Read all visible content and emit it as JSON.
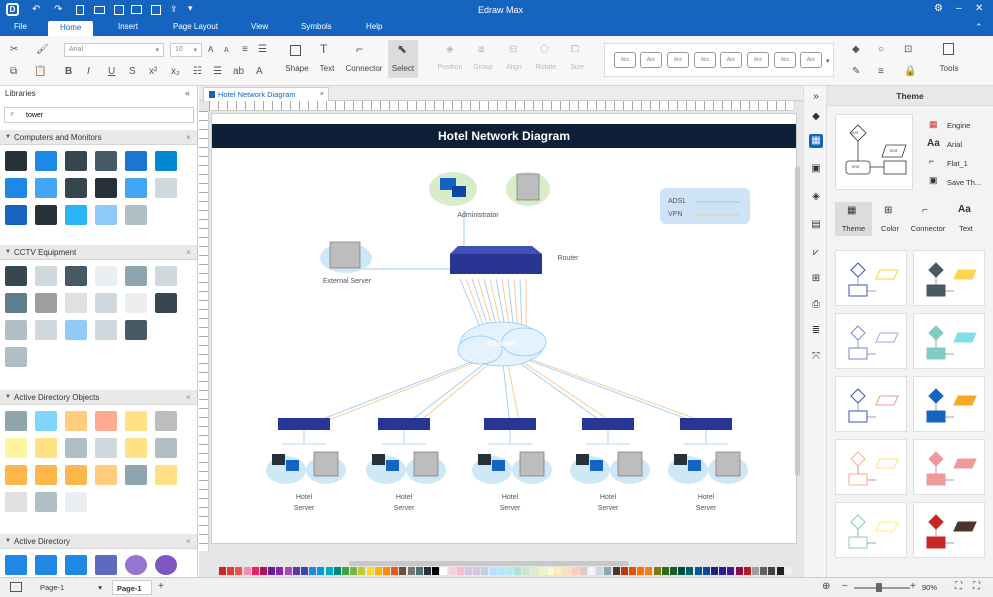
{
  "app": {
    "title": "Edraw Max"
  },
  "menus": [
    "File",
    "Home",
    "Insert",
    "Page Layout",
    "View",
    "Symbols",
    "Help"
  ],
  "ribbon": {
    "font_name": "Arial",
    "font_size": "10",
    "tools": [
      "Shape",
      "Text",
      "Connector",
      "Select"
    ],
    "arrange": [
      "Position",
      "Group",
      "Align",
      "Rotate",
      "Size"
    ],
    "style_box_label": "Abc",
    "tools_label": "Tools"
  },
  "libraries": {
    "title": "Libraries",
    "search_value": "tower",
    "categories": [
      {
        "name": "Computers and Monitors"
      },
      {
        "name": "CCTV Equipment"
      },
      {
        "name": "Active Directory Objects"
      },
      {
        "name": "Active Directory"
      }
    ]
  },
  "document": {
    "tab_label": "Hotel Network Diagram"
  },
  "diagram": {
    "title": "Hotel Network Diagram",
    "legend": [
      "ADSL",
      "VPN"
    ],
    "administrator": "Administrator",
    "router": "Router",
    "external_server": "External Server",
    "internet": "Internet",
    "hotel_label_1": "Hotel",
    "hotel_label_2": "Server"
  },
  "theme_panel": {
    "title": "Theme",
    "preview_labels": [
      "text",
      "text",
      "text"
    ],
    "options": [
      "Engine",
      "Arial",
      "Flat_1",
      "Save Th..."
    ],
    "tabs": [
      "Theme",
      "Color",
      "Connector",
      "Text"
    ]
  },
  "status": {
    "page_select": "Page-1",
    "page_tab": "Page-1",
    "zoom": "90%"
  },
  "colors": {
    "accent": "#1565c0",
    "title_bar": "#0d1f36",
    "adsl": "#9ecbf0",
    "vpn": "#f5c98a"
  }
}
